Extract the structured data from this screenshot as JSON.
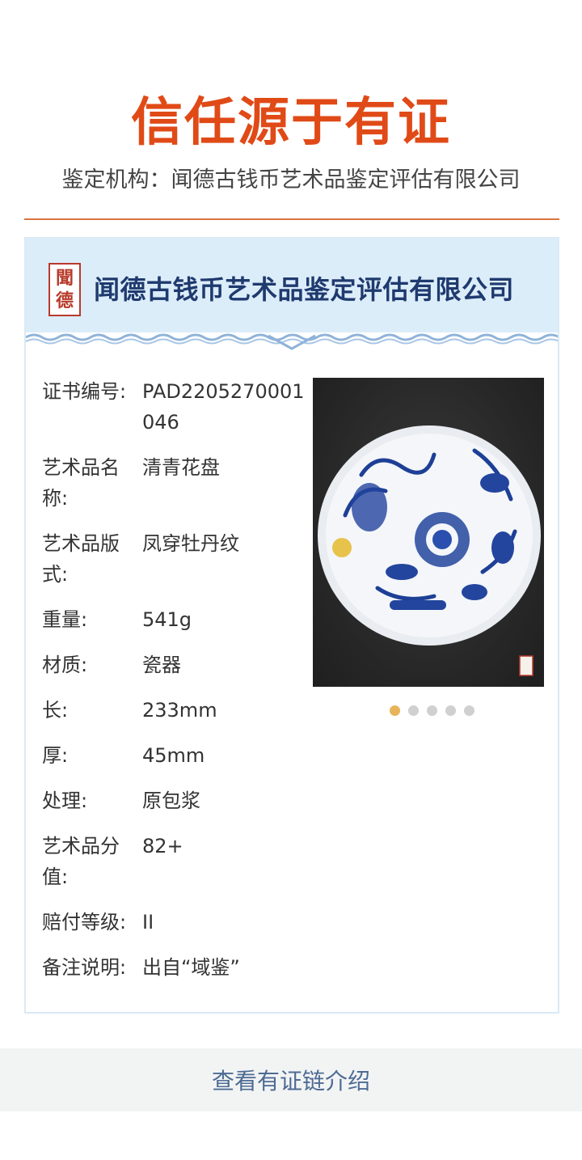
{
  "slogan": "信任源于有证",
  "agency_line": "鉴定机构：闻德古钱币艺术品鉴定评估有限公司",
  "card": {
    "header_name": "闻德古钱币艺术品鉴定评估有限公司",
    "seal_chars": [
      "聞",
      "德"
    ],
    "fields": [
      {
        "label": "证书编号:",
        "value": "PAD2205270001046"
      },
      {
        "label": "艺术品名称:",
        "value": "清青花盘"
      },
      {
        "label": "艺术品版式:",
        "value": "凤穿牡丹纹"
      },
      {
        "label": "重量:",
        "value": "541g"
      },
      {
        "label": "材质:",
        "value": "瓷器"
      },
      {
        "label": "长:",
        "value": "233mm"
      },
      {
        "label": "厚:",
        "value": "45mm"
      },
      {
        "label": "处理:",
        "value": "原包浆"
      },
      {
        "label": "艺术品分值:",
        "value": "82+"
      },
      {
        "label": "赔付等级:",
        "value": "II"
      },
      {
        "label": "备注说明:",
        "value": "出自“域鉴”"
      }
    ],
    "carousel": {
      "total": 5,
      "active_index": 0
    },
    "colors": {
      "accent": "#e04a17",
      "header_bg": "#dcedfa",
      "dot_active": "#e8b45a"
    }
  },
  "footer_link": "查看有证链介绍"
}
